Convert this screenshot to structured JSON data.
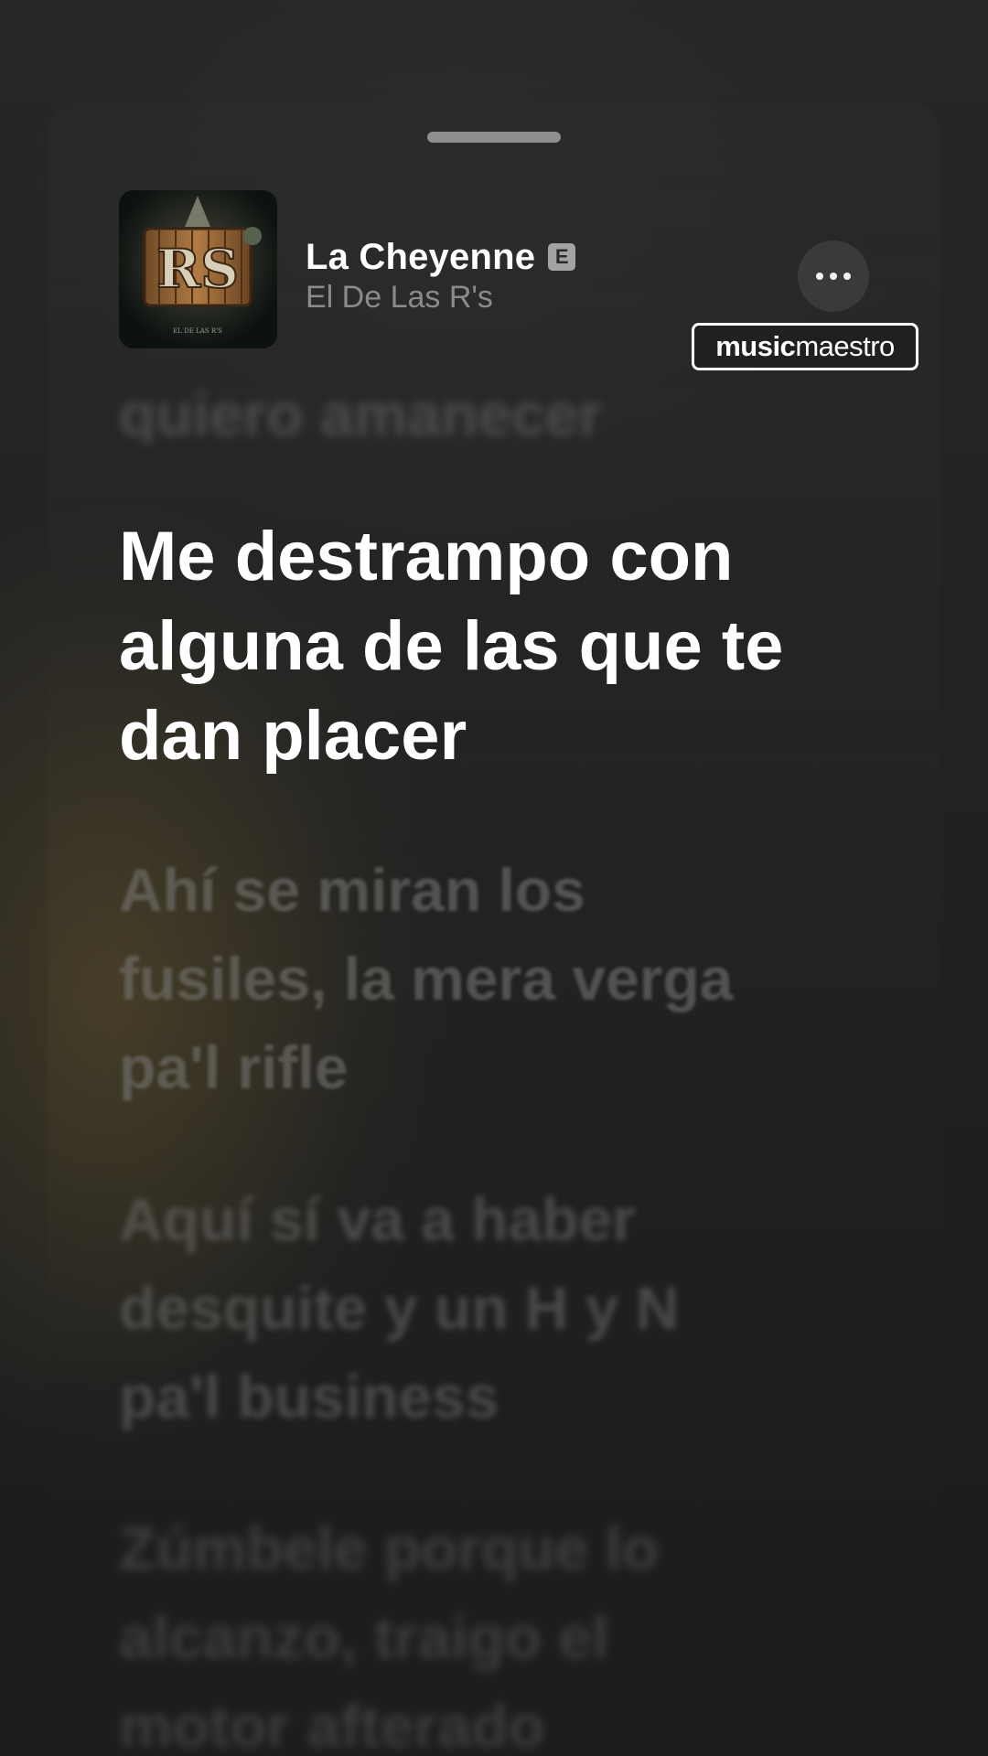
{
  "now_playing": {
    "title": "La Cheyenne",
    "explicit_badge": "E",
    "artist": "El De Las R's",
    "artwork": {
      "logo_text": "RS",
      "caption": "EL DE LAS R'S"
    },
    "more_icon": "ellipsis-icon"
  },
  "watermark": {
    "bold": "music",
    "light": "maestro"
  },
  "lyrics": {
    "previous": [
      "quiero amanecer"
    ],
    "current": [
      "Me destrampo con",
      "alguna de las que te",
      "dan placer"
    ],
    "upcoming": [
      [
        "Ahí se miran los",
        "fusiles, la mera verga",
        "pa'l rifle"
      ],
      [
        "Aquí sí va a haber",
        "desquite y un H y N",
        "pa'l business"
      ],
      [
        "Zúmbele porque lo",
        "alcanzo, traigo el",
        "motor afterado"
      ]
    ]
  },
  "colors": {
    "accent_bg": "#1e1e1e",
    "active_lyric": "#ffffff",
    "inactive_lyric": "#7a7a78",
    "artist_text": "#8a8a8a"
  }
}
